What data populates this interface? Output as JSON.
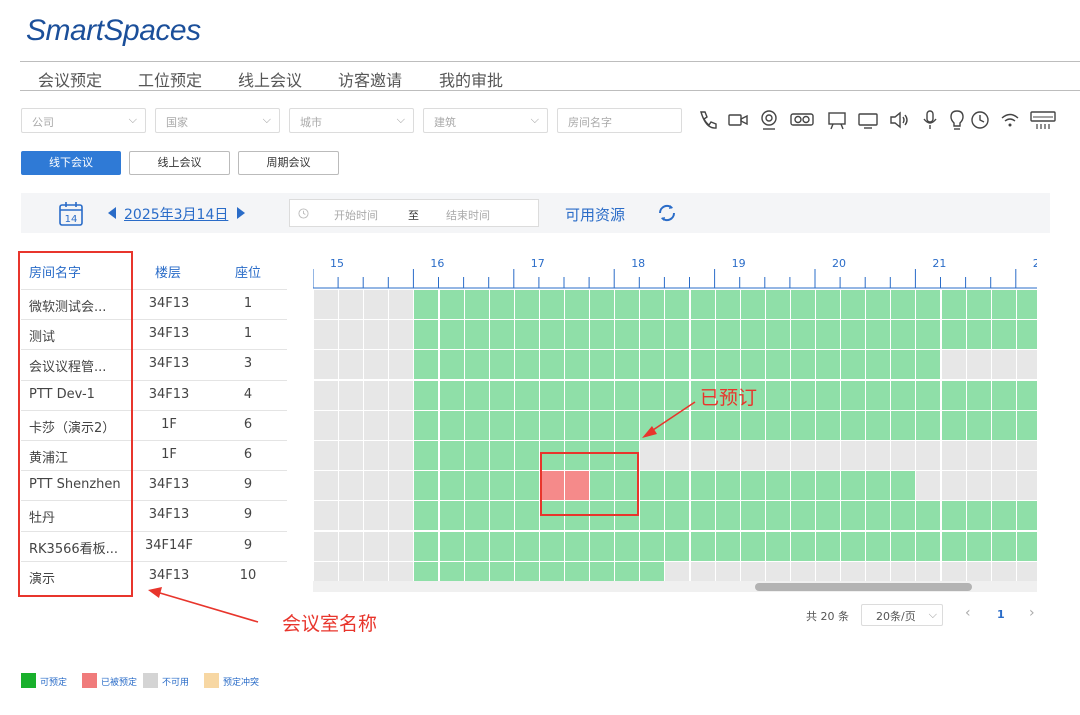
{
  "brand": {
    "logo": "SmartSpaces"
  },
  "nav": {
    "items": [
      "会议预定",
      "工位预定",
      "线上会议",
      "访客邀请",
      "我的审批"
    ]
  },
  "filters": {
    "company": "公司",
    "country": "国家",
    "city": "城市",
    "building": "建筑",
    "room_name": "房间名字"
  },
  "facility_icons": [
    "phone-icon",
    "video-camera-icon",
    "webcam-icon",
    "projector-icon",
    "whiteboard-icon",
    "display-icon",
    "speaker-icon",
    "microphone-icon",
    "lightbulb-icon",
    "clock-icon",
    "wifi-icon",
    "air-conditioner-icon"
  ],
  "modes": {
    "offline": "线下会议",
    "online": "线上会议",
    "recurring": "周期会议"
  },
  "datebar": {
    "calendar_day": "14",
    "date": "2025年3月14日",
    "start_time_placeholder": "开始时间",
    "to": "至",
    "end_time_placeholder": "结束时间",
    "available_resources": "可用资源"
  },
  "table": {
    "headers": {
      "name": "房间名字",
      "floor": "楼层",
      "seats": "座位"
    },
    "rows": [
      {
        "name": "微软测试会...",
        "floor": "34F13",
        "seats": "1"
      },
      {
        "name": "测试",
        "floor": "34F13",
        "seats": "1"
      },
      {
        "name": "会议议程管...",
        "floor": "34F13",
        "seats": "3"
      },
      {
        "name": "PTT Dev-1",
        "floor": "34F13",
        "seats": "4"
      },
      {
        "name": "卡莎（演示2）",
        "floor": "1F",
        "seats": "6"
      },
      {
        "name": "黄浦江",
        "floor": "1F",
        "seats": "6"
      },
      {
        "name": "PTT Shenzhen",
        "floor": "34F13",
        "seats": "9"
      },
      {
        "name": "牡丹",
        "floor": "34F13",
        "seats": "9"
      },
      {
        "name": "RK3566看板...",
        "floor": "34F14F",
        "seats": "9"
      },
      {
        "name": "演示",
        "floor": "34F13",
        "seats": "10"
      }
    ]
  },
  "timeline": {
    "hours": [
      "15",
      "16",
      "17",
      "18",
      "19",
      "20",
      "21",
      "2"
    ],
    "first_hour": 15,
    "slots_per_hour": 4,
    "slot_count": 29,
    "rows": [
      "uuuuggggggggggggggggggggggggg",
      "uuuuggggggggggggggggggggggggg",
      "uuuuggggggggggggggggggggguuuu",
      "uuuuggggggggggggggggggggggggg",
      "uuuuggggggggggggggggggggggggg",
      "uuuuggggggggguuuuuuuuuuuuuuuu",
      "uuuugggggbbggggggggggggguuuuu",
      "uuuuggggggggggggggggggggggggg",
      "uuuuggggggggggggggggggggggggg",
      "uuuugggggggggguuuuuuuuuuuuuuu"
    ],
    "scroll_fraction": {
      "start": 0.61,
      "end": 0.91
    }
  },
  "annotations": {
    "booked": "已预订",
    "room_names": "会议室名称"
  },
  "pagination": {
    "total": "共 20 条",
    "per_page": "20条/页",
    "prev": "‹",
    "current": "1",
    "next": "›"
  },
  "legend": [
    {
      "label": "可预定",
      "color": "#19b02c"
    },
    {
      "label": "已被预定",
      "color": "#f07b7b"
    },
    {
      "label": "不可用",
      "color": "#d4d4d4"
    },
    {
      "label": "预定冲突",
      "color": "#f7d7a3"
    }
  ],
  "colors": {
    "available": "#8fdfa8",
    "booked": "#f58a8a",
    "unavailable": "#e7e7e7",
    "accent": "#2a6cc8",
    "annotation": "#e8352c"
  }
}
